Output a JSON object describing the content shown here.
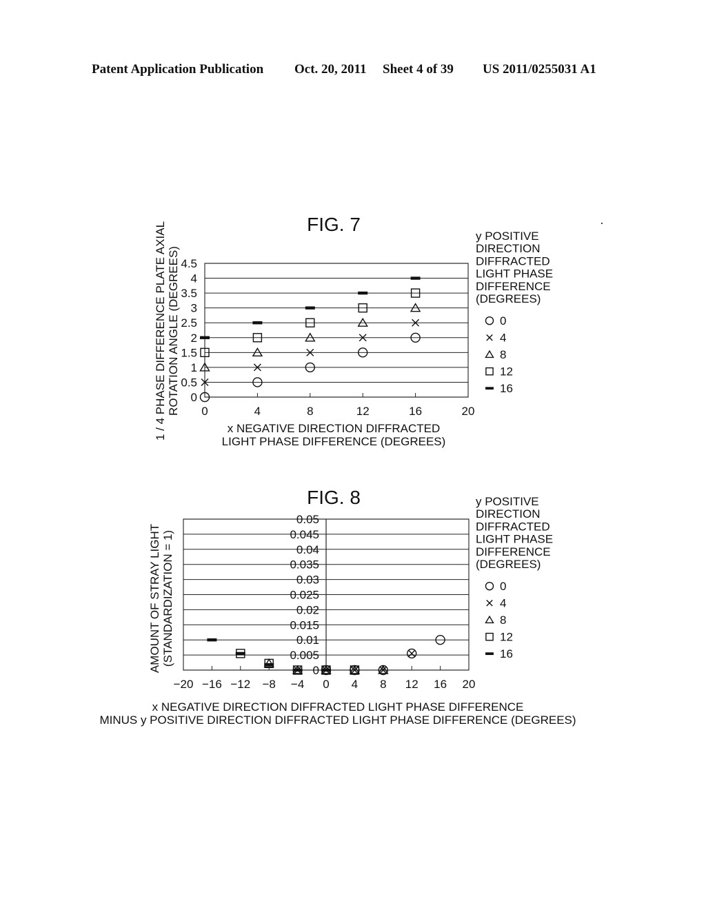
{
  "header": {
    "publication": "Patent Application Publication",
    "date": "Oct. 20, 2011",
    "sheet": "Sheet 4 of 39",
    "number": "US 2011/0255031 A1"
  },
  "chart_data": [
    {
      "type": "scatter",
      "title": "FIG. 7",
      "xlabel": [
        "x NEGATIVE DIRECTION DIFFRACTED",
        "LIGHT PHASE DIFFERENCE (DEGREES)"
      ],
      "ylabel": [
        "1 / 4 PHASE DIFFERENCE PLATE AXIAL",
        "ROTATION ANGLE (DEGREES)"
      ],
      "xlim": [
        0,
        20
      ],
      "ylim": [
        0,
        4.5
      ],
      "xticks": [
        "0",
        "4",
        "8",
        "12",
        "16",
        "20"
      ],
      "xtick_values": [
        0,
        4,
        8,
        12,
        16,
        20
      ],
      "yticks": [
        "0",
        "0.5",
        "1",
        "1.5",
        "2",
        "2.5",
        "3",
        "3.5",
        "4",
        "4.5"
      ],
      "ytick_values": [
        0,
        0.5,
        1,
        1.5,
        2,
        2.5,
        3,
        3.5,
        4,
        4.5
      ],
      "grid": "horizontal",
      "legend_title": [
        "y POSITIVE",
        "DIRECTION",
        "DIFFRACTED",
        "LIGHT PHASE",
        "DIFFERENCE",
        "(DEGREES)"
      ],
      "legend_position": "right",
      "series": [
        {
          "name": "0",
          "marker": "circle",
          "x": [
            0,
            4,
            8,
            12,
            16
          ],
          "y": [
            0,
            0.5,
            1,
            1.5,
            2
          ]
        },
        {
          "name": "4",
          "marker": "x",
          "x": [
            0,
            4,
            8,
            12,
            16
          ],
          "y": [
            0.5,
            1,
            1.5,
            2,
            2.5
          ]
        },
        {
          "name": "8",
          "marker": "triangle",
          "x": [
            0,
            4,
            8,
            12,
            16
          ],
          "y": [
            1,
            1.5,
            2,
            2.5,
            3
          ]
        },
        {
          "name": "12",
          "marker": "square",
          "x": [
            0,
            4,
            8,
            12,
            16
          ],
          "y": [
            1.5,
            2,
            2.5,
            3,
            3.5
          ]
        },
        {
          "name": "16",
          "marker": "bar",
          "x": [
            0,
            4,
            8,
            12,
            16
          ],
          "y": [
            2,
            2.5,
            3,
            3.5,
            4
          ]
        }
      ]
    },
    {
      "type": "scatter",
      "title": "FIG. 8",
      "xlabel": [
        "x NEGATIVE DIRECTION DIFFRACTED LIGHT PHASE DIFFERENCE",
        "MINUS y POSITIVE DIRECTION DIFFRACTED LIGHT PHASE DIFFERENCE (DEGREES)"
      ],
      "ylabel": [
        "AMOUNT OF STRAY LIGHT",
        "(STANDARDIZATION = 1)"
      ],
      "xlim": [
        -20,
        20
      ],
      "ylim": [
        0,
        0.05
      ],
      "xticks": [
        "−20",
        "−16",
        "−12",
        "−8",
        "−4",
        "0",
        "4",
        "8",
        "12",
        "16",
        "20"
      ],
      "xtick_values": [
        -20,
        -16,
        -12,
        -8,
        -4,
        0,
        4,
        8,
        12,
        16,
        20
      ],
      "yticks": [
        "0",
        "0.005",
        "0.01",
        "0.015",
        "0.02",
        "0.025",
        "0.03",
        "0.035",
        "0.04",
        "0.045",
        "0.05"
      ],
      "ytick_values": [
        0,
        0.005,
        0.01,
        0.015,
        0.02,
        0.025,
        0.03,
        0.035,
        0.04,
        0.045,
        0.05
      ],
      "grid": "horizontal",
      "legend_title": [
        "y POSITIVE",
        "DIRECTION",
        "DIFFRACTED",
        "LIGHT PHASE",
        "DIFFERENCE",
        "(DEGREES)"
      ],
      "legend_position": "right",
      "series": [
        {
          "name": "0",
          "marker": "circle",
          "x": [
            0,
            4,
            8,
            12,
            16
          ],
          "y": [
            0,
            0,
            0,
            0.0055,
            0.01
          ]
        },
        {
          "name": "4",
          "marker": "x",
          "x": [
            -4,
            0,
            4,
            8,
            12
          ],
          "y": [
            0,
            0,
            0,
            0,
            0.0055
          ]
        },
        {
          "name": "8",
          "marker": "triangle",
          "x": [
            -8,
            -4,
            0,
            4,
            8
          ],
          "y": [
            0.0022,
            0,
            0,
            0,
            0
          ]
        },
        {
          "name": "12",
          "marker": "square",
          "x": [
            -12,
            -8,
            -4,
            0,
            4
          ],
          "y": [
            0.0055,
            0.0022,
            0,
            0,
            0
          ]
        },
        {
          "name": "16",
          "marker": "bar",
          "x": [
            -16,
            -12,
            -8,
            -4,
            0
          ],
          "y": [
            0.01,
            0.0055,
            0.0018,
            0,
            0
          ]
        }
      ]
    }
  ]
}
